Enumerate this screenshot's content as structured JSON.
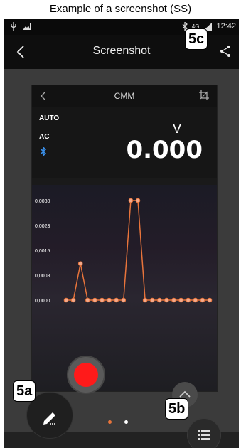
{
  "caption": "Example of a screenshot (SS)",
  "statusbar": {
    "time": "12:42",
    "network": "4G",
    "icons": [
      "usb-icon",
      "image-icon",
      "bluetooth-icon",
      "signal-icon"
    ]
  },
  "appbar": {
    "title": "Screenshot",
    "back_icon": "back-arrow-icon",
    "share_icon": "share-icon"
  },
  "inner_screen": {
    "title": "CMM",
    "mode_auto": "AUTO",
    "mode_ac": "AC",
    "unit": "V",
    "reading": "0.000"
  },
  "chart_data": {
    "type": "line",
    "ytick_labels": [
      "0,0030",
      "0,0023",
      "0,0015",
      "0,0008",
      "0,0000"
    ],
    "ylim": [
      0,
      0.003
    ],
    "values": [
      0.0,
      0.0,
      0.0011,
      0.0,
      0.0,
      0.0,
      0.0,
      0.0,
      0.0,
      0.003,
      0.003,
      0.0,
      0.0,
      0.0,
      0.0,
      0.0,
      0.0,
      0.0,
      0.0,
      0.0,
      0.0
    ],
    "line_color": "#e8743b",
    "grid": false
  },
  "pager": {
    "active_color": "#e8743b",
    "inactive_color": "#ffffff"
  },
  "labels": {
    "a": "5a",
    "b": "5b",
    "c": "5c"
  }
}
